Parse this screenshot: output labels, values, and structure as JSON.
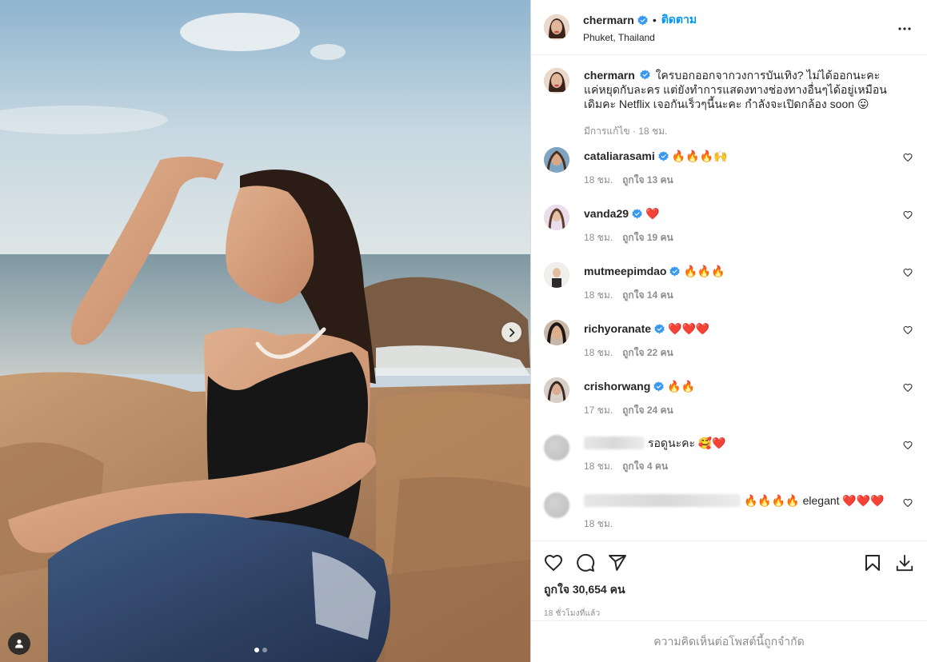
{
  "colors": {
    "accent": "#0095f6",
    "verified": "#3897f0",
    "muted": "#8e8e8e",
    "text": "#262626"
  },
  "photo": {
    "next_icon": "chevron-right-icon",
    "tag_icon": "user-icon",
    "carousel_dots": 2,
    "active_dot": 1
  },
  "header": {
    "username": "chermarn",
    "bullet": "•",
    "follow_label": "ติดตาม",
    "location": "Phuket, Thailand",
    "more_icon": "more-horizontal-icon"
  },
  "caption": {
    "username": "chermarn",
    "text": "ใครบอกออกจากวงการบันเทิง? ไม่ได้ออกนะคะ แค่หยุดกับละคร แต่ยังทำการแสดงทางช่องทางอื่นๆได้อยู่เหมือนเดิมคะ Netflix เจอกันเร็วๆนี้นะคะ กำลังจะเปิดกล้อง soon 😛",
    "meta": "มีการแก้ไข · 18 ชม."
  },
  "comments": [
    {
      "username": "cataliarasami",
      "verified": true,
      "text": "🔥🔥🔥🙌",
      "time": "18 ชม.",
      "likes": "ถูกใจ 13 คน"
    },
    {
      "username": "vanda29",
      "verified": true,
      "text": "❤️",
      "time": "18 ชม.",
      "likes": "ถูกใจ 19 คน"
    },
    {
      "username": "mutmeepimdao",
      "verified": true,
      "text": "🔥🔥🔥",
      "time": "18 ชม.",
      "likes": "ถูกใจ 14 คน"
    },
    {
      "username": "richyoranate",
      "verified": true,
      "text": "❤️❤️❤️",
      "time": "18 ชม.",
      "likes": "ถูกใจ 22 คน"
    },
    {
      "username": "crishorwang",
      "verified": true,
      "text": "🔥🔥",
      "time": "17 ชม.",
      "likes": "ถูกใจ 24 คน"
    },
    {
      "username": "",
      "verified": false,
      "text": "รอดูนะคะ 🥰❤️",
      "time": "18 ชม.",
      "likes": "ถูกใจ 4 คน"
    },
    {
      "username": "",
      "verified": false,
      "text": "🔥🔥🔥🔥 elegant ❤️❤️❤️",
      "time": "18 ชม.",
      "likes": ""
    }
  ],
  "actions": {
    "like_icon": "heart-icon",
    "comment_icon": "comment-icon",
    "share_icon": "send-icon",
    "save_icon": "bookmark-icon",
    "download_icon": "download-icon",
    "likes_total": "ถูกใจ 30,654 คน",
    "time_ago": "18 ชั่วโมงที่แล้ว"
  },
  "restricted_notice": "ความคิดเห็นต่อโพสต์นี้ถูกจำกัด"
}
